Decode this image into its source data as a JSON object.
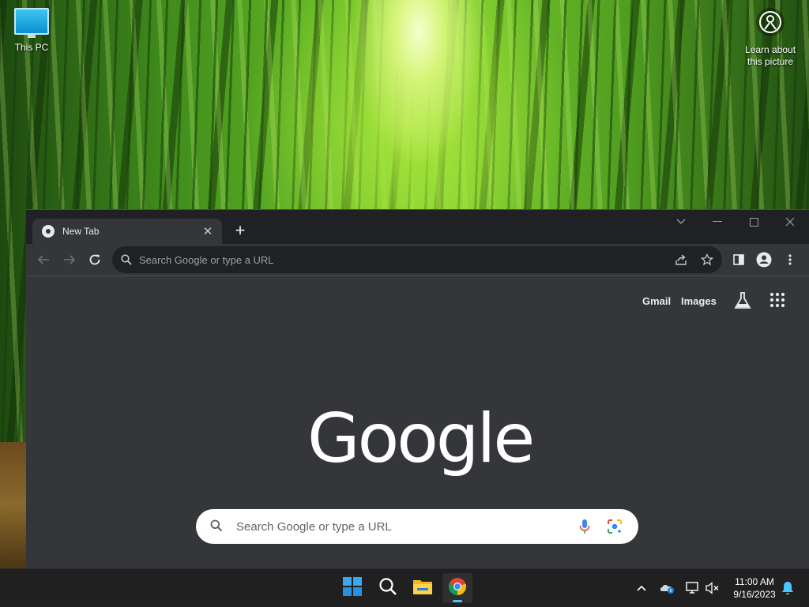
{
  "desktop": {
    "icons": [
      {
        "label": "This PC",
        "icon": "monitor-icon"
      },
      {
        "label": "Learn about\nthis picture",
        "icon": "learn-about-picture-icon"
      }
    ],
    "learn_line1": "Learn about",
    "learn_line2": "this picture"
  },
  "browser": {
    "tab": {
      "title": "New Tab",
      "favicon": "chrome-icon"
    },
    "omnibox_placeholder": "Search Google or type a URL",
    "ntp": {
      "gmail_label": "Gmail",
      "images_label": "Images",
      "logo_text": "Google",
      "search_placeholder": "Search Google or type a URL"
    },
    "colors": {
      "frame": "#202124",
      "toolbar": "#35363a",
      "accent": "#8ab4f8"
    }
  },
  "taskbar": {
    "apps": [
      "start-icon",
      "search-icon",
      "file-explorer-icon",
      "chrome-icon"
    ],
    "active_app": "chrome-icon",
    "time": "11:00 AM",
    "date": "9/16/2023",
    "colors": {
      "background": "#202020",
      "indicator": "#4cc2ff"
    }
  }
}
